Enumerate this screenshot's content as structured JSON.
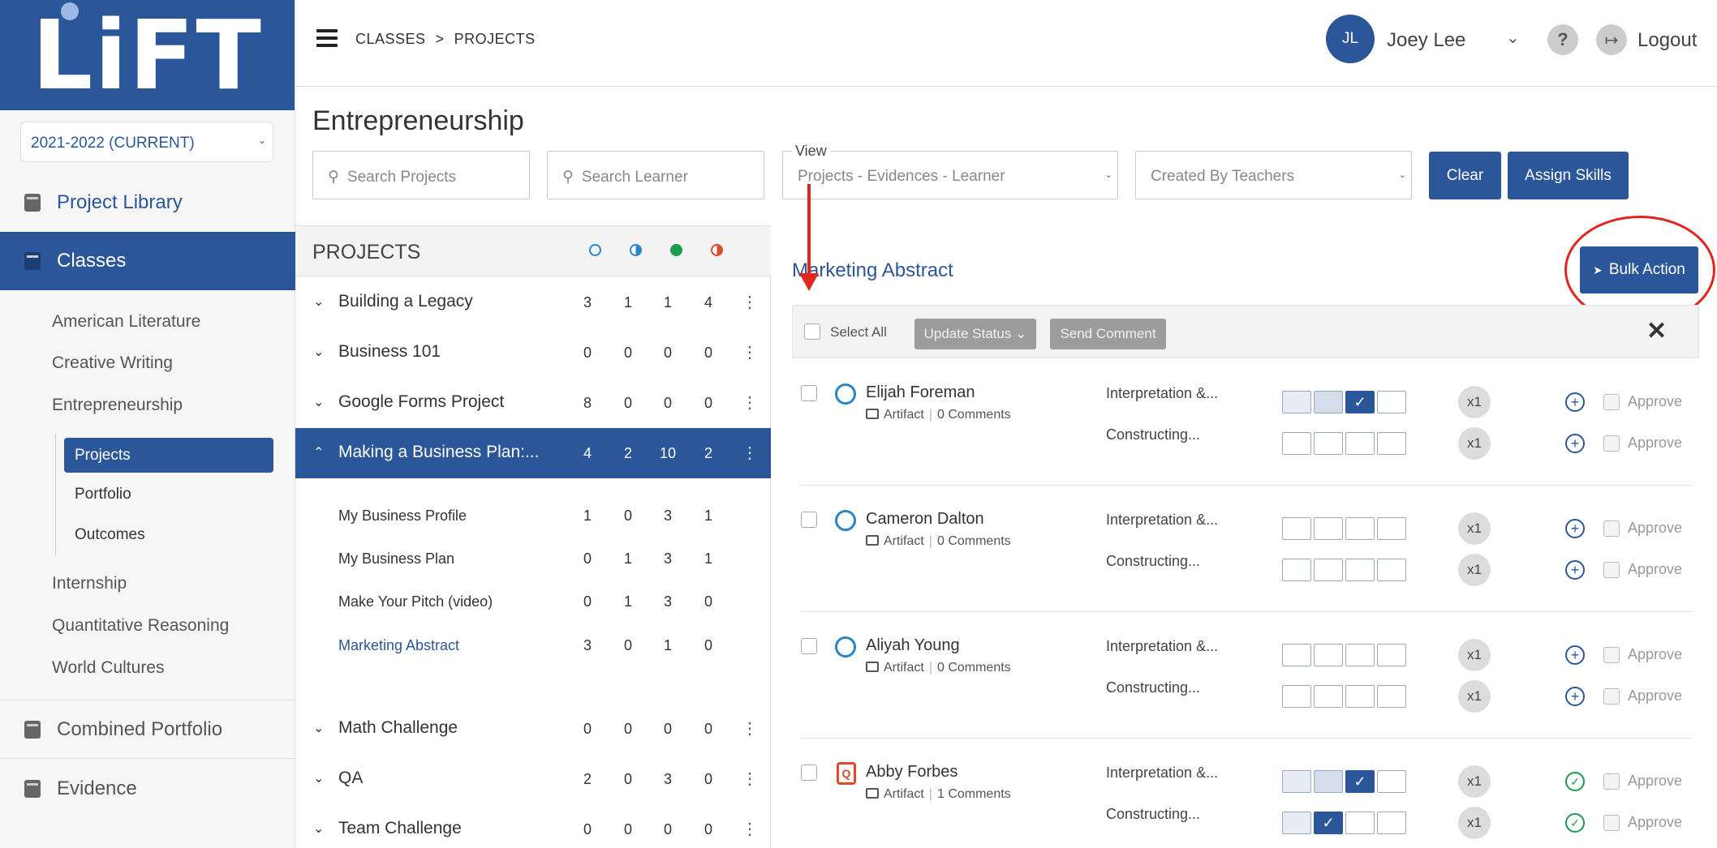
{
  "app": {
    "logo_text": "LiFT",
    "brand_color": "#2b579a",
    "annotation_color": "#e0261e"
  },
  "sidebar": {
    "year_select": "2021-2022 (CURRENT)",
    "project_library": "Project Library",
    "classes": "Classes",
    "class_list": [
      "American Literature",
      "Creative Writing",
      "Entrepreneurship",
      "Internship",
      "Quantitative Reasoning",
      "World Cultures"
    ],
    "sub_items": [
      "Projects",
      "Portfolio",
      "Outcomes"
    ],
    "combined_portfolio": "Combined Portfolio",
    "evidence": "Evidence"
  },
  "header": {
    "breadcrumb": [
      "CLASSES",
      "PROJECTS"
    ],
    "breadcrumb_sep": ">",
    "user_initials": "JL",
    "user_name": "Joey Lee",
    "help": "?",
    "logout": "Logout"
  },
  "page": {
    "title": "Entrepreneurship",
    "search_projects_placeholder": "Search Projects",
    "search_learner_placeholder": "Search Learner",
    "view_label": "View",
    "view_value": "Projects - Evidences - Learner",
    "created_by_value": "Created By Teachers",
    "clear": "Clear",
    "assign_skills": "Assign Skills"
  },
  "projects_panel": {
    "heading": "PROJECTS",
    "status_colors": [
      "#2a86c8",
      "#2a86c8",
      "#1d9a4b",
      "#e04a2b"
    ],
    "projects": [
      {
        "name": "Building a Legacy",
        "counts": [
          "3",
          "1",
          "1",
          "4"
        ]
      },
      {
        "name": "Business 101",
        "counts": [
          "0",
          "0",
          "0",
          "0"
        ]
      },
      {
        "name": "Google Forms Project",
        "counts": [
          "8",
          "0",
          "0",
          "0"
        ]
      },
      {
        "name": "Making a Business Plan:...",
        "counts": [
          "4",
          "2",
          "10",
          "2"
        ]
      },
      {
        "name": "Math Challenge",
        "counts": [
          "0",
          "0",
          "0",
          "0"
        ]
      },
      {
        "name": "QA",
        "counts": [
          "2",
          "0",
          "3",
          "0"
        ]
      },
      {
        "name": "Team Challenge",
        "counts": [
          "0",
          "0",
          "0",
          "0"
        ]
      }
    ],
    "sub_projects": [
      {
        "name": "My Business Profile",
        "counts": [
          "1",
          "0",
          "3",
          "1"
        ]
      },
      {
        "name": "My Business Plan",
        "counts": [
          "0",
          "1",
          "3",
          "1"
        ]
      },
      {
        "name": "Make Your Pitch (video)",
        "counts": [
          "0",
          "1",
          "3",
          "0"
        ]
      },
      {
        "name": "Marketing Abstract",
        "counts": [
          "3",
          "0",
          "1",
          "0"
        ]
      }
    ]
  },
  "detail": {
    "title": "Marketing Abstract",
    "bulk_action": "Bulk Action",
    "select_all": "Select All",
    "update_status": "Update Status",
    "send_comment": "Send Comment",
    "close": "✕",
    "artifact_label": "Artifact",
    "comments_label": "Comments",
    "approve_label": "Approve",
    "multiplier": "x1",
    "learners": [
      {
        "name": "Elijah Foreman",
        "comments": "0",
        "status": "ring",
        "skills": [
          {
            "name": "Interpretation &...",
            "grid": [
              "lite",
              "mid",
              "on",
              "off"
            ],
            "added": false
          },
          {
            "name": "Constructing...",
            "grid": [
              "off",
              "off",
              "off",
              "off"
            ],
            "added": false
          }
        ]
      },
      {
        "name": "Cameron Dalton",
        "comments": "0",
        "status": "ring",
        "skills": [
          {
            "name": "Interpretation &...",
            "grid": [
              "off",
              "off",
              "off",
              "off"
            ],
            "added": false
          },
          {
            "name": "Constructing...",
            "grid": [
              "off",
              "off",
              "off",
              "off"
            ],
            "added": false
          }
        ]
      },
      {
        "name": "Aliyah Young",
        "comments": "0",
        "status": "ring",
        "skills": [
          {
            "name": "Interpretation &...",
            "grid": [
              "off",
              "off",
              "off",
              "off"
            ],
            "added": false
          },
          {
            "name": "Constructing...",
            "grid": [
              "off",
              "off",
              "off",
              "off"
            ],
            "added": false
          }
        ]
      },
      {
        "name": "Abby Forbes",
        "comments": "1",
        "status": "doc",
        "skills": [
          {
            "name": "Interpretation &...",
            "grid": [
              "lite",
              "mid",
              "on",
              "off"
            ],
            "added": true
          },
          {
            "name": "Constructing...",
            "grid": [
              "lite",
              "on",
              "off",
              "off"
            ],
            "added": true
          }
        ]
      }
    ]
  }
}
